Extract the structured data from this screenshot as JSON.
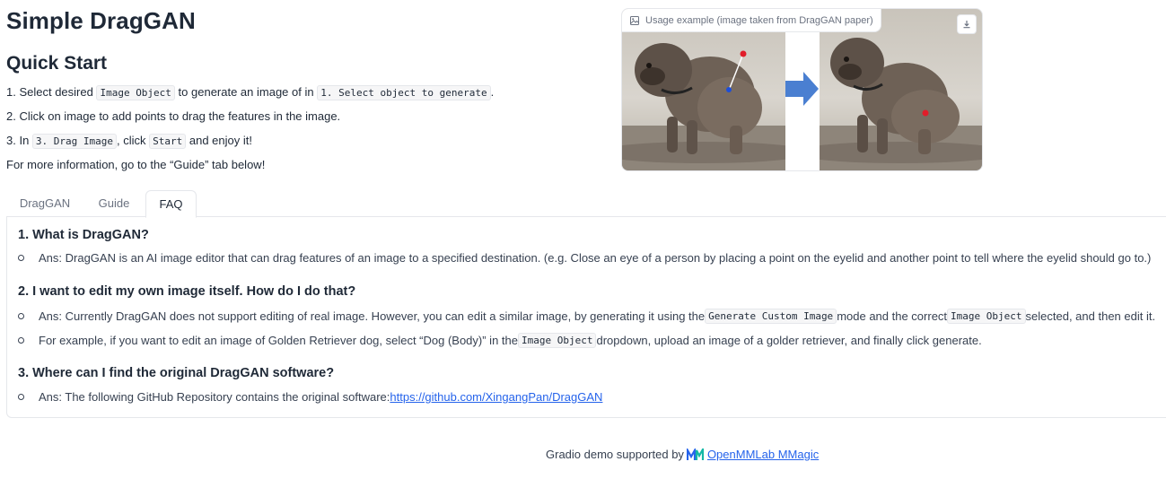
{
  "header": {
    "title": "Simple DragGAN",
    "subtitle": "Quick Start"
  },
  "steps": {
    "s1_a": "1. Select desired ",
    "s1_code1": "Image Object",
    "s1_b": " to generate an image of in ",
    "s1_code2": "1. Select object to generate",
    "s1_c": ".",
    "s2": "2. Click on image to add points to drag the features in the image.",
    "s3_a": "3. In ",
    "s3_code1": "3. Drag Image",
    "s3_b": ", click ",
    "s3_code2": "Start",
    "s3_c": " and enjoy it!",
    "s4": "For more information, go to the “Guide” tab below!"
  },
  "image_panel": {
    "label": "Usage example (image taken from DragGAN paper)",
    "label_icon": "image-icon",
    "download_icon": "download-icon"
  },
  "tabs": [
    {
      "label": "DragGAN",
      "active": false
    },
    {
      "label": "Guide",
      "active": false
    },
    {
      "label": "FAQ",
      "active": true
    }
  ],
  "faq": {
    "q1": "1. What is DragGAN?",
    "q1_a1": "Ans: DragGAN is an AI image editor that can drag features of an image to a specified destination. (e.g. Close an eye of a person by placing a point on the eyelid and another point to tell where the eyelid should go to.)",
    "q2": "2. I want to edit my own image itself. How do I do that?",
    "q2_a1_pre": "Ans: Currently DragGAN does not support editing of real image. However, you can edit a similar image, by generating it using the ",
    "q2_a1_code1": "Generate Custom Image",
    "q2_a1_mid": " mode and the correct ",
    "q2_a1_code2": "Image Object",
    "q2_a1_post": " selected, and then edit it.",
    "q2_a2_pre": "For example, if you want to edit an image of Golden Retriever dog, select “Dog (Body)” in the ",
    "q2_a2_code": "Image Object",
    "q2_a2_post": " dropdown, upload an image of a golder retriever, and finally click generate.",
    "q3": "3. Where can I find the original DragGAN software?",
    "q3_a1_pre": "Ans: The following GitHub Repository contains the original software: ",
    "q3_a1_link": "https://github.com/XingangPan/DragGAN"
  },
  "footer": {
    "prefix": "Gradio demo supported by ",
    "link": "OpenMMLab MMagic",
    "logo_icon": "mmagic-logo-icon"
  },
  "colors": {
    "accent_link": "#2563eb",
    "border": "#e5e7eb",
    "arrow_blue": "#4a7fd1",
    "handle_red": "#e11d2a"
  }
}
